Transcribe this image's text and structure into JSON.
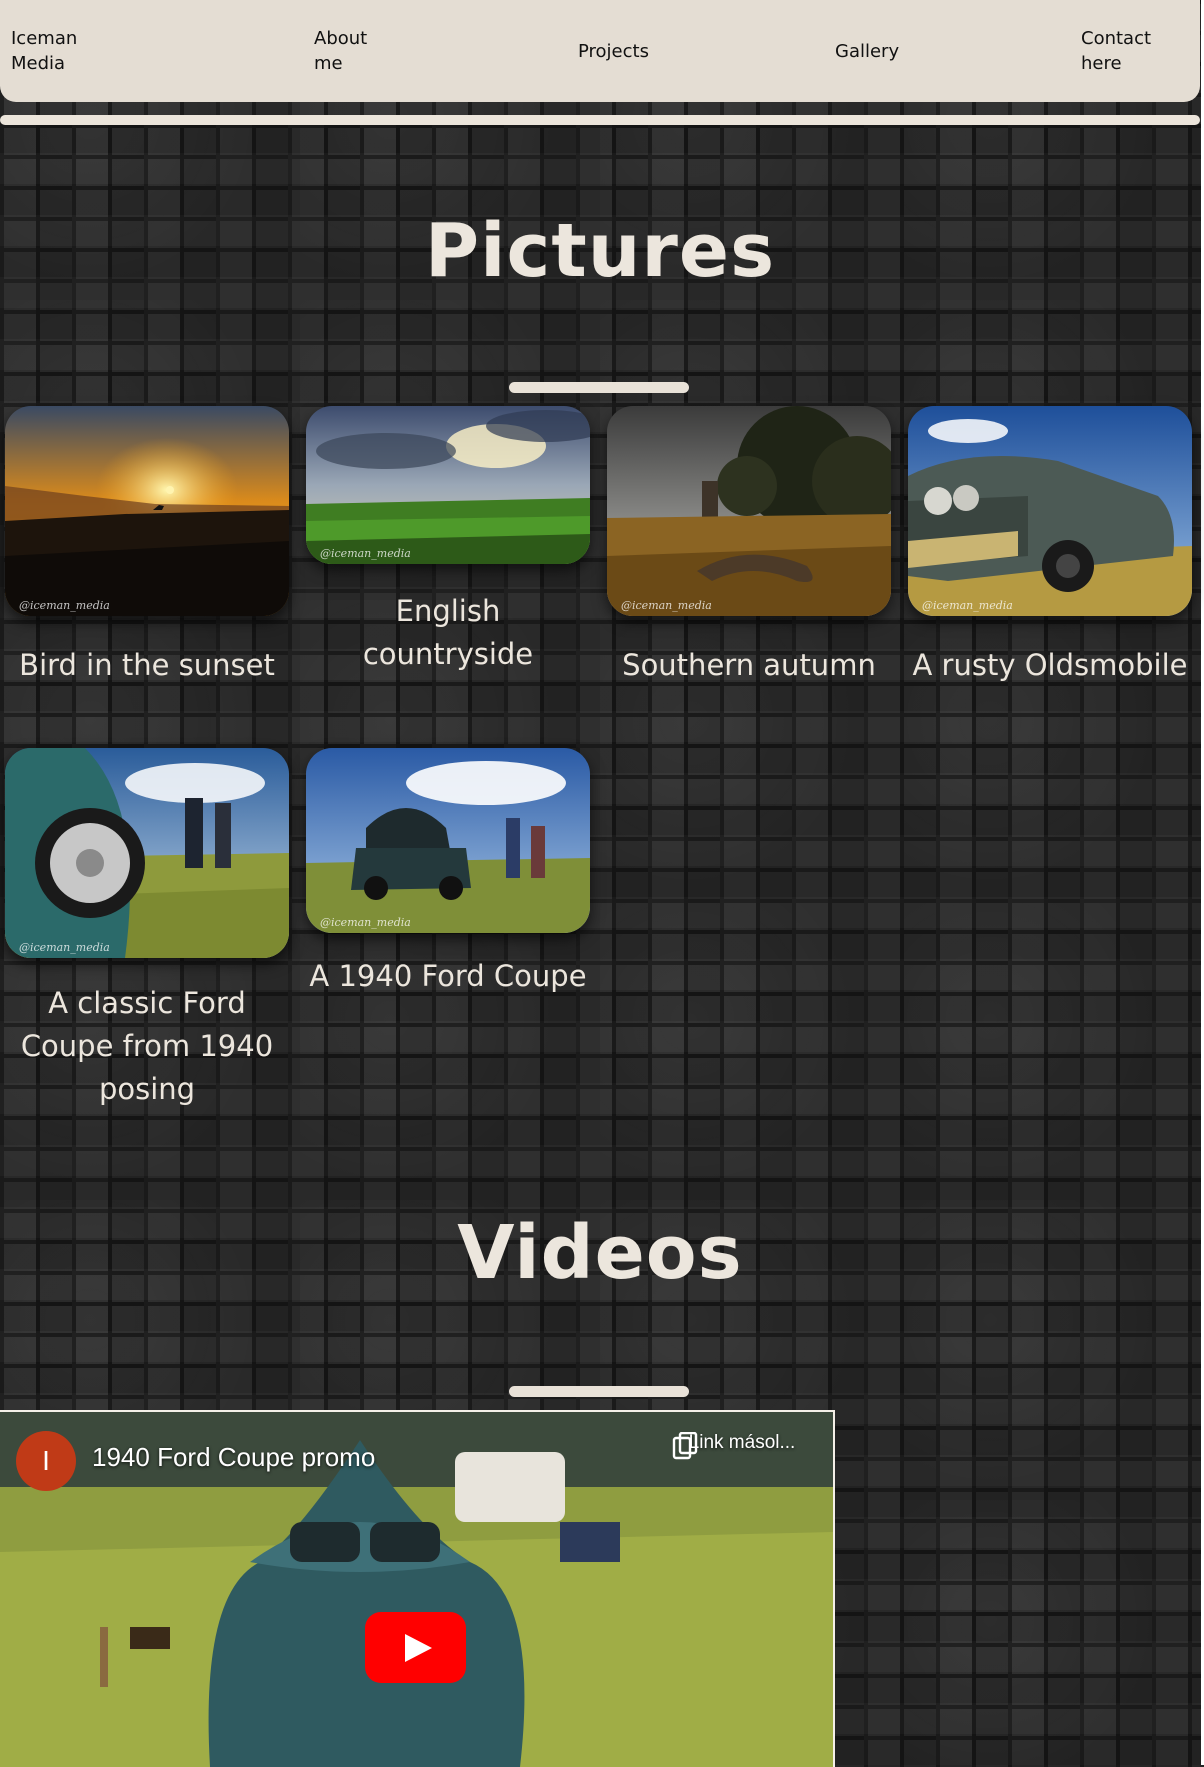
{
  "nav": {
    "brand": "Iceman\nMedia",
    "about": "About\nme",
    "projects": "Projects",
    "gallery": "Gallery",
    "contact": "Contact\nhere"
  },
  "pictures": {
    "heading": "Pictures",
    "watermark": "@iceman_media",
    "items": [
      {
        "caption": "Bird in the sunset"
      },
      {
        "caption": "English countryside"
      },
      {
        "caption": "Southern autumn"
      },
      {
        "caption": "A rusty Oldsmobile"
      },
      {
        "caption": "A classic Ford Coupe from 1940 posing"
      },
      {
        "caption": "A 1940 Ford Coupe"
      }
    ]
  },
  "videos": {
    "heading": "Videos",
    "video": {
      "channel_initial": "I",
      "title": "1940 Ford Coupe promo",
      "copy_label": "Link másol..."
    }
  },
  "colors": {
    "nav_bg": "#e4ddd3",
    "text_light": "#ece6dd",
    "play_red": "#ff0000",
    "avatar": "#c03a17"
  }
}
